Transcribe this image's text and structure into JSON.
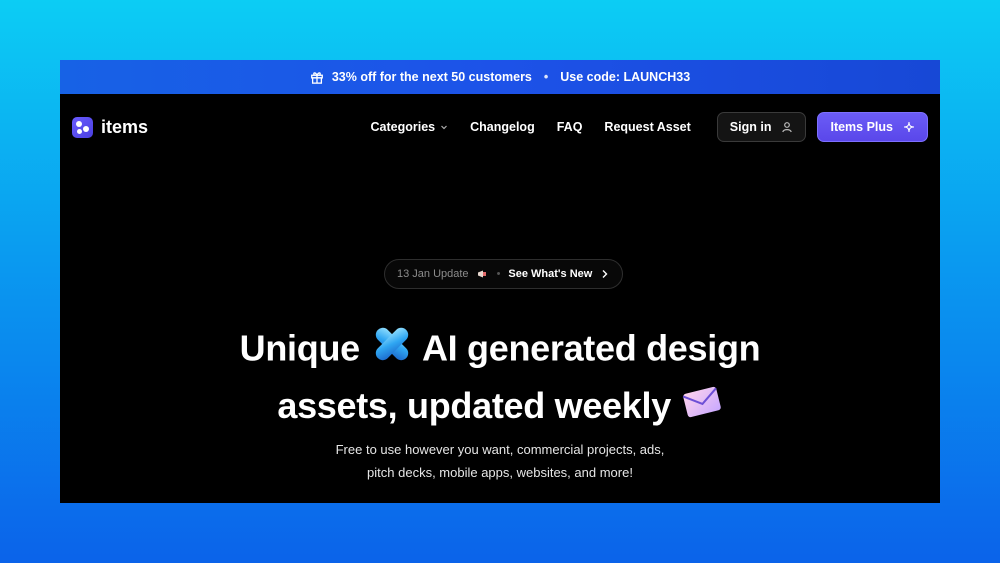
{
  "promo": {
    "gift_icon": "gift-icon",
    "offer": "33% off for the next 50 customers",
    "separator": "•",
    "code": "Use code: LAUNCH33"
  },
  "nav": {
    "logo_text": "items",
    "links": [
      "Categories",
      "Changelog",
      "FAQ",
      "Request Asset"
    ],
    "signin_label": "Sign in",
    "plus_label": "Items Plus"
  },
  "badge": {
    "date": "13 Jan Update",
    "separator": "•",
    "link": "See What's New"
  },
  "hero": {
    "title_line1_a": "Unique",
    "title_line1_b": "AI generated design",
    "title_line2": "assets, updated weekly",
    "subtitle_line1": "Free to use however you want, commercial projects, ads,",
    "subtitle_line2": "pitch decks, mobile apps, websites, and more!"
  },
  "colors": {
    "accent": "#5a47ea",
    "promo_bar": "#1d52e8",
    "background": "#000000"
  }
}
